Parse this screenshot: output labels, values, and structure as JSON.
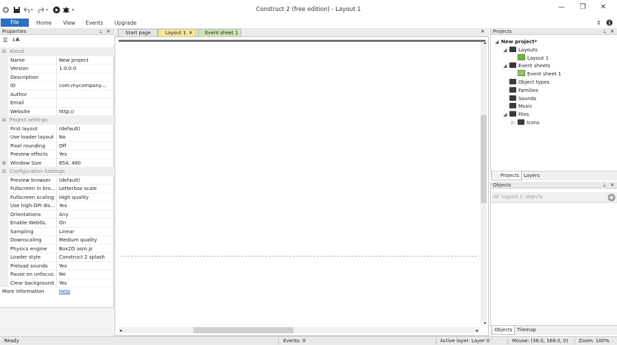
{
  "window": {
    "title": "Construct 2  (free edition) - Layout 1",
    "controls": {
      "minimize": "—",
      "maximize": "❐",
      "close": "✕"
    }
  },
  "ribbon": {
    "tabs": [
      {
        "label": "File"
      },
      {
        "label": "Home"
      },
      {
        "label": "View"
      },
      {
        "label": "Events"
      },
      {
        "label": "Upgrade"
      }
    ]
  },
  "properties": {
    "header": "Properties",
    "rows": [
      {
        "type": "category",
        "label": "About"
      },
      {
        "key": "Name",
        "value": "New project"
      },
      {
        "key": "Version",
        "value": "1.0.0.0"
      },
      {
        "key": "Description",
        "value": ""
      },
      {
        "key": "ID",
        "value": "com.mycompany...."
      },
      {
        "key": "Author",
        "value": ""
      },
      {
        "key": "Email",
        "value": ""
      },
      {
        "key": "Website",
        "value": "http://"
      },
      {
        "type": "category",
        "label": "Project settings"
      },
      {
        "key": "First layout",
        "value": "(default)"
      },
      {
        "key": "Use loader layout",
        "value": "No"
      },
      {
        "key": "Pixel rounding",
        "value": "Off"
      },
      {
        "key": "Preview effects",
        "value": "Yes"
      },
      {
        "key": "Window Size",
        "value": "854, 480",
        "expandable": true
      },
      {
        "type": "category",
        "label": "Configuration Settings"
      },
      {
        "key": "Preview browser",
        "value": "(default)"
      },
      {
        "key": "Fullscreen in bro...",
        "value": "Letterbox scale"
      },
      {
        "key": "Fullscreen scaling",
        "value": "High quality"
      },
      {
        "key": "Use high-DPI dis...",
        "value": "Yes"
      },
      {
        "key": "Orientations",
        "value": "Any"
      },
      {
        "key": "Enable WebGL",
        "value": "On"
      },
      {
        "key": "Sampling",
        "value": "Linear"
      },
      {
        "key": "Downscaling",
        "value": "Medium quality"
      },
      {
        "key": "Physics engine",
        "value": "Box2D asm.js"
      },
      {
        "key": "Loader style",
        "value": "Construct 2 splash"
      },
      {
        "key": "Preload sounds",
        "value": "Yes"
      },
      {
        "key": "Pause on unfocus",
        "value": "No"
      },
      {
        "key": "Clear background",
        "value": "Yes"
      }
    ],
    "more_info_label": "More information",
    "help_link": "Help"
  },
  "doc_tabs": [
    {
      "label": "Start page"
    },
    {
      "label": "Layout 1",
      "active": true
    },
    {
      "label": "Event sheet 1"
    }
  ],
  "projects": {
    "header": "Projects",
    "tree": [
      {
        "label": "New project*",
        "level": 0,
        "arrow": "◢",
        "bold": true,
        "icon": "project"
      },
      {
        "label": "Layouts",
        "level": 1,
        "arrow": "◢",
        "icon": "folder"
      },
      {
        "label": "Layout 1",
        "level": 2,
        "arrow": "",
        "icon": "layout"
      },
      {
        "label": "Event sheets",
        "level": 1,
        "arrow": "◢",
        "icon": "folder"
      },
      {
        "label": "Event sheet 1",
        "level": 2,
        "arrow": "",
        "icon": "eventsheet"
      },
      {
        "label": "Object types",
        "level": 1,
        "arrow": "",
        "icon": "folder"
      },
      {
        "label": "Families",
        "level": 1,
        "arrow": "",
        "icon": "folder"
      },
      {
        "label": "Sounds",
        "level": 1,
        "arrow": "",
        "icon": "folder"
      },
      {
        "label": "Music",
        "level": 1,
        "arrow": "",
        "icon": "folder"
      },
      {
        "label": "Files",
        "level": 1,
        "arrow": "◢",
        "icon": "folder"
      },
      {
        "label": "Icons",
        "level": 2,
        "arrow": "▷",
        "icon": "folder"
      }
    ],
    "bottom_tabs": [
      {
        "label": "Projects",
        "active": true
      },
      {
        "label": "Layers"
      }
    ]
  },
  "objects": {
    "header": "Objects",
    "search_placeholder": "All 'Layout 1' objects",
    "bottom_tabs": [
      {
        "label": "Objects",
        "active": true
      },
      {
        "label": "Tilemap"
      }
    ]
  },
  "status": {
    "ready": "Ready",
    "events": "Events: 0",
    "active_layer": "Active layer: Layer 0",
    "mouse": "Mouse: (36.0, 168.0, 0)",
    "zoom": "Zoom: 100%"
  }
}
